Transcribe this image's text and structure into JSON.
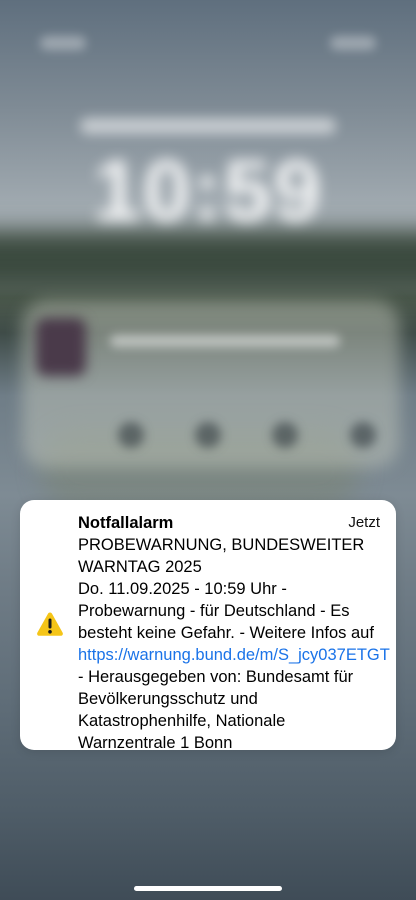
{
  "notification": {
    "app_title": "Notfallalarm",
    "time_label": "Jetzt",
    "icon": "warning-triangle-icon",
    "headline": "PROBEWARNUNG, BUNDESWEITER WARNTAG 2025",
    "body_intro": "Do. 11.09.2025 - 10:59 Uhr - Probewarnung - für Deutschland - Es besteht keine Gefahr. - Weitere Infos auf",
    "link_text": "https://warnung.bund.de/m/S_jcy037ETGT",
    "body_outro": "- Herausgegeben von: Bundesamt für Bevölkerungsschutz und Katastrophenhilfe, Nationale Warnzentrale 1 Bonn"
  },
  "colors": {
    "card_background": "#ffffff",
    "link": "#1a73e8",
    "warning_yellow": "#f5c518"
  }
}
